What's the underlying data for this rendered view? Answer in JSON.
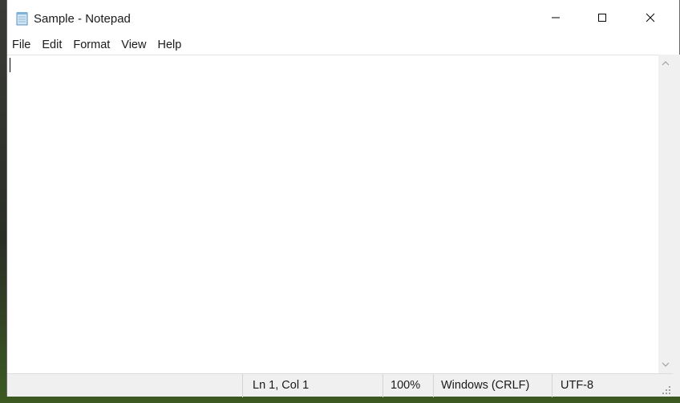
{
  "window": {
    "title": "Sample - Notepad"
  },
  "menu": {
    "items": [
      "File",
      "Edit",
      "Format",
      "View",
      "Help"
    ]
  },
  "editor": {
    "content": ""
  },
  "status": {
    "position": "Ln 1, Col 1",
    "zoom": "100%",
    "line_endings": "Windows (CRLF)",
    "encoding": "UTF-8"
  },
  "icons": {
    "app": "notepad-icon",
    "minimize": "minimize-icon",
    "maximize": "maximize-icon",
    "close": "close-icon"
  }
}
